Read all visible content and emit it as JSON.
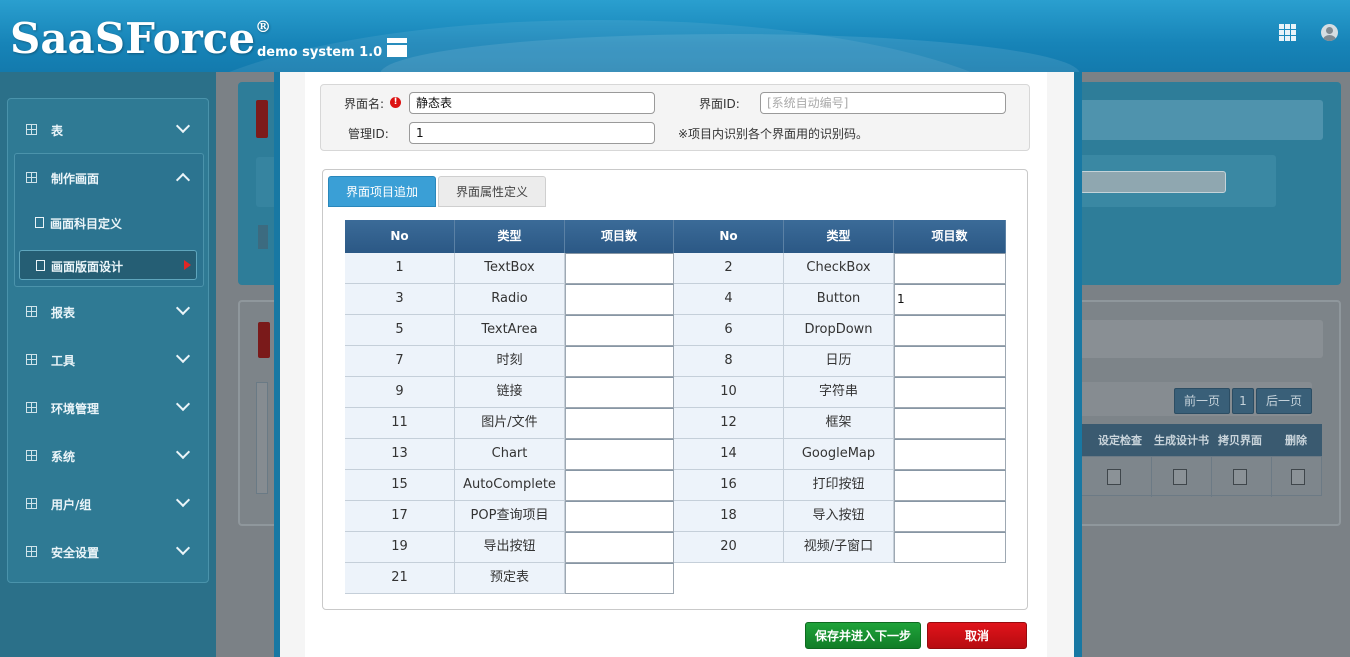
{
  "header": {
    "logo_text": "SaaSForce",
    "logo_mark": "®",
    "subtitle": "demo system 1.0"
  },
  "sidebar": {
    "items": [
      {
        "label": "表"
      },
      {
        "label": "制作画面"
      },
      {
        "label": "报表"
      },
      {
        "label": "工具"
      },
      {
        "label": "环境管理"
      },
      {
        "label": "系统"
      },
      {
        "label": "用户/组"
      },
      {
        "label": "安全设置"
      }
    ],
    "subitems": [
      {
        "label": "画面科目定义"
      },
      {
        "label": "画面版面设计"
      }
    ]
  },
  "background": {
    "pager": {
      "prev": "前一页",
      "page": "1",
      "next": "后一页"
    },
    "table_headers": [
      "设定检查",
      "生成设计书",
      "拷贝界面",
      "删除"
    ]
  },
  "form": {
    "screen_name_label": "界面名:",
    "screen_name_value": "静态表",
    "screen_id_label": "界面ID:",
    "screen_id_placeholder": "[系统自动编号]",
    "manage_id_label": "管理ID:",
    "manage_id_value": "1",
    "note": "※项目内识别各个界面用的识别码。"
  },
  "tabs": [
    {
      "label": "界面项目追加"
    },
    {
      "label": "界面属性定义"
    }
  ],
  "grid": {
    "headers": [
      "No",
      "类型",
      "项目数",
      "No",
      "类型",
      "项目数"
    ],
    "rows": [
      {
        "no": "1",
        "type": "TextBox",
        "count": ""
      },
      {
        "no": "2",
        "type": "CheckBox",
        "count": ""
      },
      {
        "no": "3",
        "type": "Radio",
        "count": ""
      },
      {
        "no": "4",
        "type": "Button",
        "count": "1"
      },
      {
        "no": "5",
        "type": "TextArea",
        "count": ""
      },
      {
        "no": "6",
        "type": "DropDown",
        "count": ""
      },
      {
        "no": "7",
        "type": "时刻",
        "count": ""
      },
      {
        "no": "8",
        "type": "日历",
        "count": ""
      },
      {
        "no": "9",
        "type": "链接",
        "count": ""
      },
      {
        "no": "10",
        "type": "字符串",
        "count": ""
      },
      {
        "no": "11",
        "type": "图片/文件",
        "count": ""
      },
      {
        "no": "12",
        "type": "框架",
        "count": ""
      },
      {
        "no": "13",
        "type": "Chart",
        "count": ""
      },
      {
        "no": "14",
        "type": "GoogleMap",
        "count": ""
      },
      {
        "no": "15",
        "type": "AutoComplete",
        "count": ""
      },
      {
        "no": "16",
        "type": "打印按钮",
        "count": ""
      },
      {
        "no": "17",
        "type": "POP查询项目",
        "count": ""
      },
      {
        "no": "18",
        "type": "导入按钮",
        "count": ""
      },
      {
        "no": "19",
        "type": "导出按钮",
        "count": ""
      },
      {
        "no": "20",
        "type": "视频/子窗口",
        "count": ""
      },
      {
        "no": "21",
        "type": "预定表",
        "count": ""
      }
    ]
  },
  "buttons": {
    "save": "保存并进入下一步",
    "cancel": "取消"
  },
  "colors": {
    "header": "#1784b8",
    "tab_active": "#3a9fd6",
    "grid_header": "#2b5885",
    "save": "#117d27",
    "cancel": "#b70b10"
  }
}
